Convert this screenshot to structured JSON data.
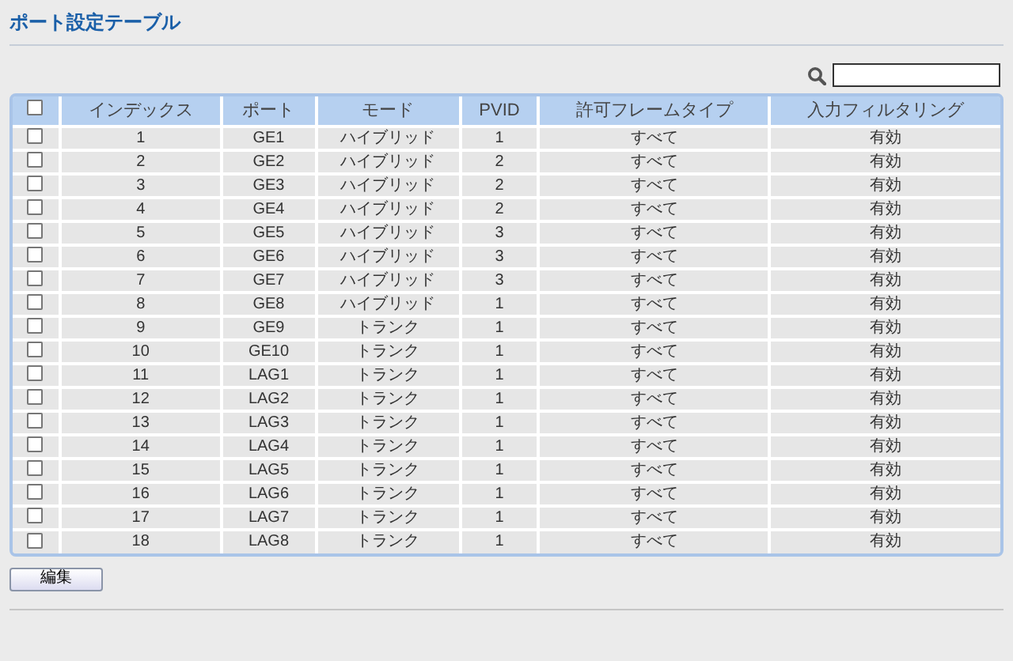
{
  "title": "ポート設定テーブル",
  "table": {
    "select_all": {
      "checked": false
    },
    "columns": [
      "インデックス",
      "ポート",
      "モード",
      "PVID",
      "許可フレームタイプ",
      "入力フィルタリング"
    ],
    "rows": [
      {
        "checked": false,
        "cells": [
          "1",
          "GE1",
          "ハイブリッド",
          "1",
          "すべて",
          "有効"
        ]
      },
      {
        "checked": false,
        "cells": [
          "2",
          "GE2",
          "ハイブリッド",
          "2",
          "すべて",
          "有効"
        ]
      },
      {
        "checked": false,
        "cells": [
          "3",
          "GE3",
          "ハイブリッド",
          "2",
          "すべて",
          "有効"
        ]
      },
      {
        "checked": false,
        "cells": [
          "4",
          "GE4",
          "ハイブリッド",
          "2",
          "すべて",
          "有効"
        ]
      },
      {
        "checked": false,
        "cells": [
          "5",
          "GE5",
          "ハイブリッド",
          "3",
          "すべて",
          "有効"
        ]
      },
      {
        "checked": false,
        "cells": [
          "6",
          "GE6",
          "ハイブリッド",
          "3",
          "すべて",
          "有効"
        ]
      },
      {
        "checked": false,
        "cells": [
          "7",
          "GE7",
          "ハイブリッド",
          "3",
          "すべて",
          "有効"
        ]
      },
      {
        "checked": false,
        "cells": [
          "8",
          "GE8",
          "ハイブリッド",
          "1",
          "すべて",
          "有効"
        ]
      },
      {
        "checked": false,
        "cells": [
          "9",
          "GE9",
          "トランク",
          "1",
          "すべて",
          "有効"
        ]
      },
      {
        "checked": false,
        "cells": [
          "10",
          "GE10",
          "トランク",
          "1",
          "すべて",
          "有効"
        ]
      },
      {
        "checked": false,
        "cells": [
          "11",
          "LAG1",
          "トランク",
          "1",
          "すべて",
          "有効"
        ]
      },
      {
        "checked": false,
        "cells": [
          "12",
          "LAG2",
          "トランク",
          "1",
          "すべて",
          "有効"
        ]
      },
      {
        "checked": false,
        "cells": [
          "13",
          "LAG3",
          "トランク",
          "1",
          "すべて",
          "有効"
        ]
      },
      {
        "checked": false,
        "cells": [
          "14",
          "LAG4",
          "トランク",
          "1",
          "すべて",
          "有効"
        ]
      },
      {
        "checked": false,
        "cells": [
          "15",
          "LAG5",
          "トランク",
          "1",
          "すべて",
          "有効"
        ]
      },
      {
        "checked": false,
        "cells": [
          "16",
          "LAG6",
          "トランク",
          "1",
          "すべて",
          "有効"
        ]
      },
      {
        "checked": false,
        "cells": [
          "17",
          "LAG7",
          "トランク",
          "1",
          "すべて",
          "有効"
        ]
      },
      {
        "checked": false,
        "cells": [
          "18",
          "LAG8",
          "トランク",
          "1",
          "すべて",
          "有効"
        ]
      }
    ]
  },
  "buttons": [
    "編集"
  ]
}
